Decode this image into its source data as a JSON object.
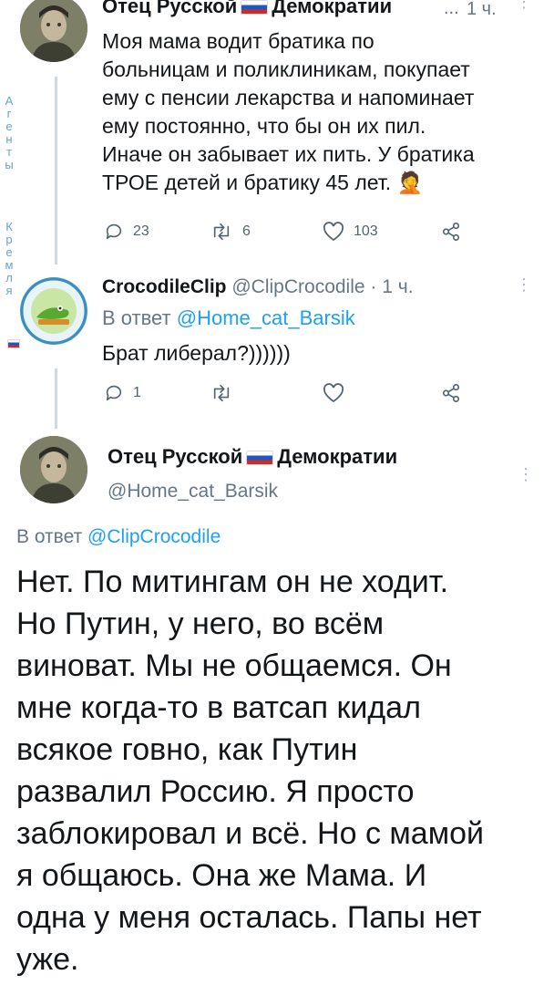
{
  "tweet1": {
    "display_name_a": "Отец Русской",
    "display_name_b": "Демократии",
    "ellipsis": "...",
    "time": "1 ч.",
    "text": "Моя мама водит братика по\nбольницам и поликлиникам, покупает\nему с пенсии лекарства и напоминает\nему постоянно, что бы он их пил.\nИначе он забывает их пить. У братика\nТРОЕ детей и братику 45 лет.",
    "emoji": "🤦",
    "replies": "23",
    "retweets": "6",
    "likes": "103"
  },
  "tweet2": {
    "display_name": "CrocodileClip",
    "handle": "@ClipCrocodile",
    "time": "· 1 ч.",
    "reply_prefix": "В ответ",
    "reply_to": "@Home_cat_Barsik",
    "text": "Брат либерал?))))))",
    "replies": "1"
  },
  "tweet3": {
    "display_name_a": "Отец Русской",
    "display_name_b": "Демократии",
    "handle": "@Home_cat_Barsik",
    "reply_prefix": "В ответ",
    "reply_to": "@ClipCrocodile",
    "text": "Нет. По митингам он не ходит.\nНо Путин, у него, во всём\nвиноват. Мы не общаемся. Он\nмне когда-то в ватсап кидал\nвсякое говно, как Путин\nразвалил Россию. Я просто\nзаблокировал и всё. Но с мамой\nя общаюсь. Она же Мама. И\nодна у меня осталась. Папы нет\nуже."
  },
  "side_label": {
    "word1": [
      "А",
      "г",
      "е",
      "н",
      "т",
      "ы"
    ],
    "word2": [
      "К",
      "р",
      "е",
      "м",
      "л",
      "я"
    ]
  },
  "colors": {
    "accent": "#1da1f2",
    "muted": "#657786",
    "thread_line": "#cfd9de"
  }
}
